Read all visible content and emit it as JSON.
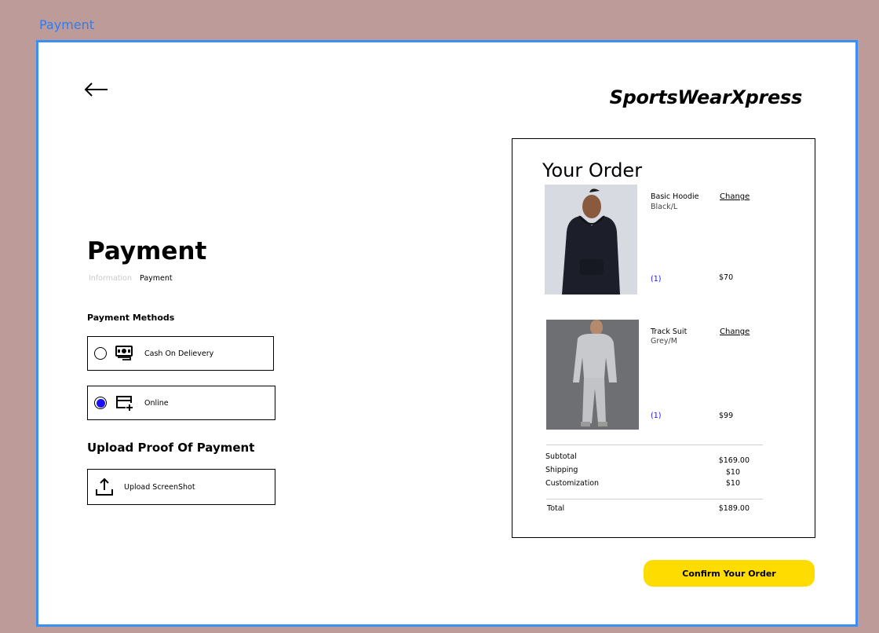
{
  "frame": {
    "label": "Payment"
  },
  "header": {
    "brand": "SportsWearXpress",
    "back_icon": "arrow-left-icon"
  },
  "page": {
    "title": "Payment",
    "breadcrumb": {
      "inactive": "Information",
      "active": "Payment"
    }
  },
  "payment_methods": {
    "label": "Payment Methods",
    "options": [
      {
        "label": "Cash On Delievery",
        "selected": false,
        "icon": "cash-icon"
      },
      {
        "label": "Online",
        "selected": true,
        "icon": "card-add-icon"
      }
    ]
  },
  "upload": {
    "title": "Upload Proof Of Payment",
    "button_label": "Upload ScreenShot",
    "icon": "upload-icon"
  },
  "order": {
    "title": "Your Order",
    "items": [
      {
        "name": "Basic Hoodie",
        "variant": "Black/L",
        "change_label": "Change",
        "qty": "(1)",
        "price": "$70"
      },
      {
        "name": "Track Suit",
        "variant": "Grey/M",
        "change_label": "Change",
        "qty": "(1)",
        "price": "$99"
      }
    ],
    "summary": {
      "subtotal_label": "Subtotal",
      "subtotal_value": "$169.00",
      "shipping_label": "Shipping",
      "shipping_value": "$10",
      "customization_label": "Customization",
      "customization_value": "$10",
      "total_label": "Total",
      "total_value": "$189.00"
    }
  },
  "actions": {
    "confirm_label": "Confirm Your Order"
  },
  "colors": {
    "accent_yellow": "#ffdc00",
    "radio_blue": "#1a0fff",
    "frame_blue": "#3b8ef3",
    "background": "#bd9b98"
  }
}
